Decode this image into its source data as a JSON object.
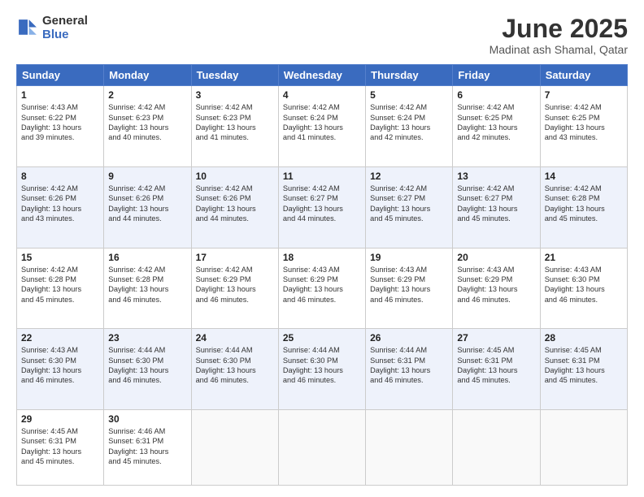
{
  "header": {
    "logo_general": "General",
    "logo_blue": "Blue",
    "main_title": "June 2025",
    "subtitle": "Madinat ash Shamal, Qatar"
  },
  "calendar": {
    "days_of_week": [
      "Sunday",
      "Monday",
      "Tuesday",
      "Wednesday",
      "Thursday",
      "Friday",
      "Saturday"
    ],
    "weeks": [
      [
        null,
        {
          "num": "2",
          "sunrise": "4:42 AM",
          "sunset": "6:23 PM",
          "daylight": "13 hours and 40 minutes."
        },
        {
          "num": "3",
          "sunrise": "4:42 AM",
          "sunset": "6:23 PM",
          "daylight": "13 hours and 41 minutes."
        },
        {
          "num": "4",
          "sunrise": "4:42 AM",
          "sunset": "6:24 PM",
          "daylight": "13 hours and 41 minutes."
        },
        {
          "num": "5",
          "sunrise": "4:42 AM",
          "sunset": "6:24 PM",
          "daylight": "13 hours and 42 minutes."
        },
        {
          "num": "6",
          "sunrise": "4:42 AM",
          "sunset": "6:25 PM",
          "daylight": "13 hours and 42 minutes."
        },
        {
          "num": "7",
          "sunrise": "4:42 AM",
          "sunset": "6:25 PM",
          "daylight": "13 hours and 43 minutes."
        }
      ],
      [
        {
          "num": "1",
          "sunrise": "4:43 AM",
          "sunset": "6:22 PM",
          "daylight": "13 hours and 39 minutes."
        },
        null,
        null,
        null,
        null,
        null,
        null
      ],
      [
        {
          "num": "8",
          "sunrise": "4:42 AM",
          "sunset": "6:26 PM",
          "daylight": "13 hours and 43 minutes."
        },
        {
          "num": "9",
          "sunrise": "4:42 AM",
          "sunset": "6:26 PM",
          "daylight": "13 hours and 44 minutes."
        },
        {
          "num": "10",
          "sunrise": "4:42 AM",
          "sunset": "6:26 PM",
          "daylight": "13 hours and 44 minutes."
        },
        {
          "num": "11",
          "sunrise": "4:42 AM",
          "sunset": "6:27 PM",
          "daylight": "13 hours and 44 minutes."
        },
        {
          "num": "12",
          "sunrise": "4:42 AM",
          "sunset": "6:27 PM",
          "daylight": "13 hours and 45 minutes."
        },
        {
          "num": "13",
          "sunrise": "4:42 AM",
          "sunset": "6:27 PM",
          "daylight": "13 hours and 45 minutes."
        },
        {
          "num": "14",
          "sunrise": "4:42 AM",
          "sunset": "6:28 PM",
          "daylight": "13 hours and 45 minutes."
        }
      ],
      [
        {
          "num": "15",
          "sunrise": "4:42 AM",
          "sunset": "6:28 PM",
          "daylight": "13 hours and 45 minutes."
        },
        {
          "num": "16",
          "sunrise": "4:42 AM",
          "sunset": "6:28 PM",
          "daylight": "13 hours and 46 minutes."
        },
        {
          "num": "17",
          "sunrise": "4:42 AM",
          "sunset": "6:29 PM",
          "daylight": "13 hours and 46 minutes."
        },
        {
          "num": "18",
          "sunrise": "4:43 AM",
          "sunset": "6:29 PM",
          "daylight": "13 hours and 46 minutes."
        },
        {
          "num": "19",
          "sunrise": "4:43 AM",
          "sunset": "6:29 PM",
          "daylight": "13 hours and 46 minutes."
        },
        {
          "num": "20",
          "sunrise": "4:43 AM",
          "sunset": "6:29 PM",
          "daylight": "13 hours and 46 minutes."
        },
        {
          "num": "21",
          "sunrise": "4:43 AM",
          "sunset": "6:30 PM",
          "daylight": "13 hours and 46 minutes."
        }
      ],
      [
        {
          "num": "22",
          "sunrise": "4:43 AM",
          "sunset": "6:30 PM",
          "daylight": "13 hours and 46 minutes."
        },
        {
          "num": "23",
          "sunrise": "4:44 AM",
          "sunset": "6:30 PM",
          "daylight": "13 hours and 46 minutes."
        },
        {
          "num": "24",
          "sunrise": "4:44 AM",
          "sunset": "6:30 PM",
          "daylight": "13 hours and 46 minutes."
        },
        {
          "num": "25",
          "sunrise": "4:44 AM",
          "sunset": "6:30 PM",
          "daylight": "13 hours and 46 minutes."
        },
        {
          "num": "26",
          "sunrise": "4:44 AM",
          "sunset": "6:31 PM",
          "daylight": "13 hours and 46 minutes."
        },
        {
          "num": "27",
          "sunrise": "4:45 AM",
          "sunset": "6:31 PM",
          "daylight": "13 hours and 45 minutes."
        },
        {
          "num": "28",
          "sunrise": "4:45 AM",
          "sunset": "6:31 PM",
          "daylight": "13 hours and 45 minutes."
        }
      ],
      [
        {
          "num": "29",
          "sunrise": "4:45 AM",
          "sunset": "6:31 PM",
          "daylight": "13 hours and 45 minutes."
        },
        {
          "num": "30",
          "sunrise": "4:46 AM",
          "sunset": "6:31 PM",
          "daylight": "13 hours and 45 minutes."
        },
        null,
        null,
        null,
        null,
        null
      ]
    ]
  }
}
